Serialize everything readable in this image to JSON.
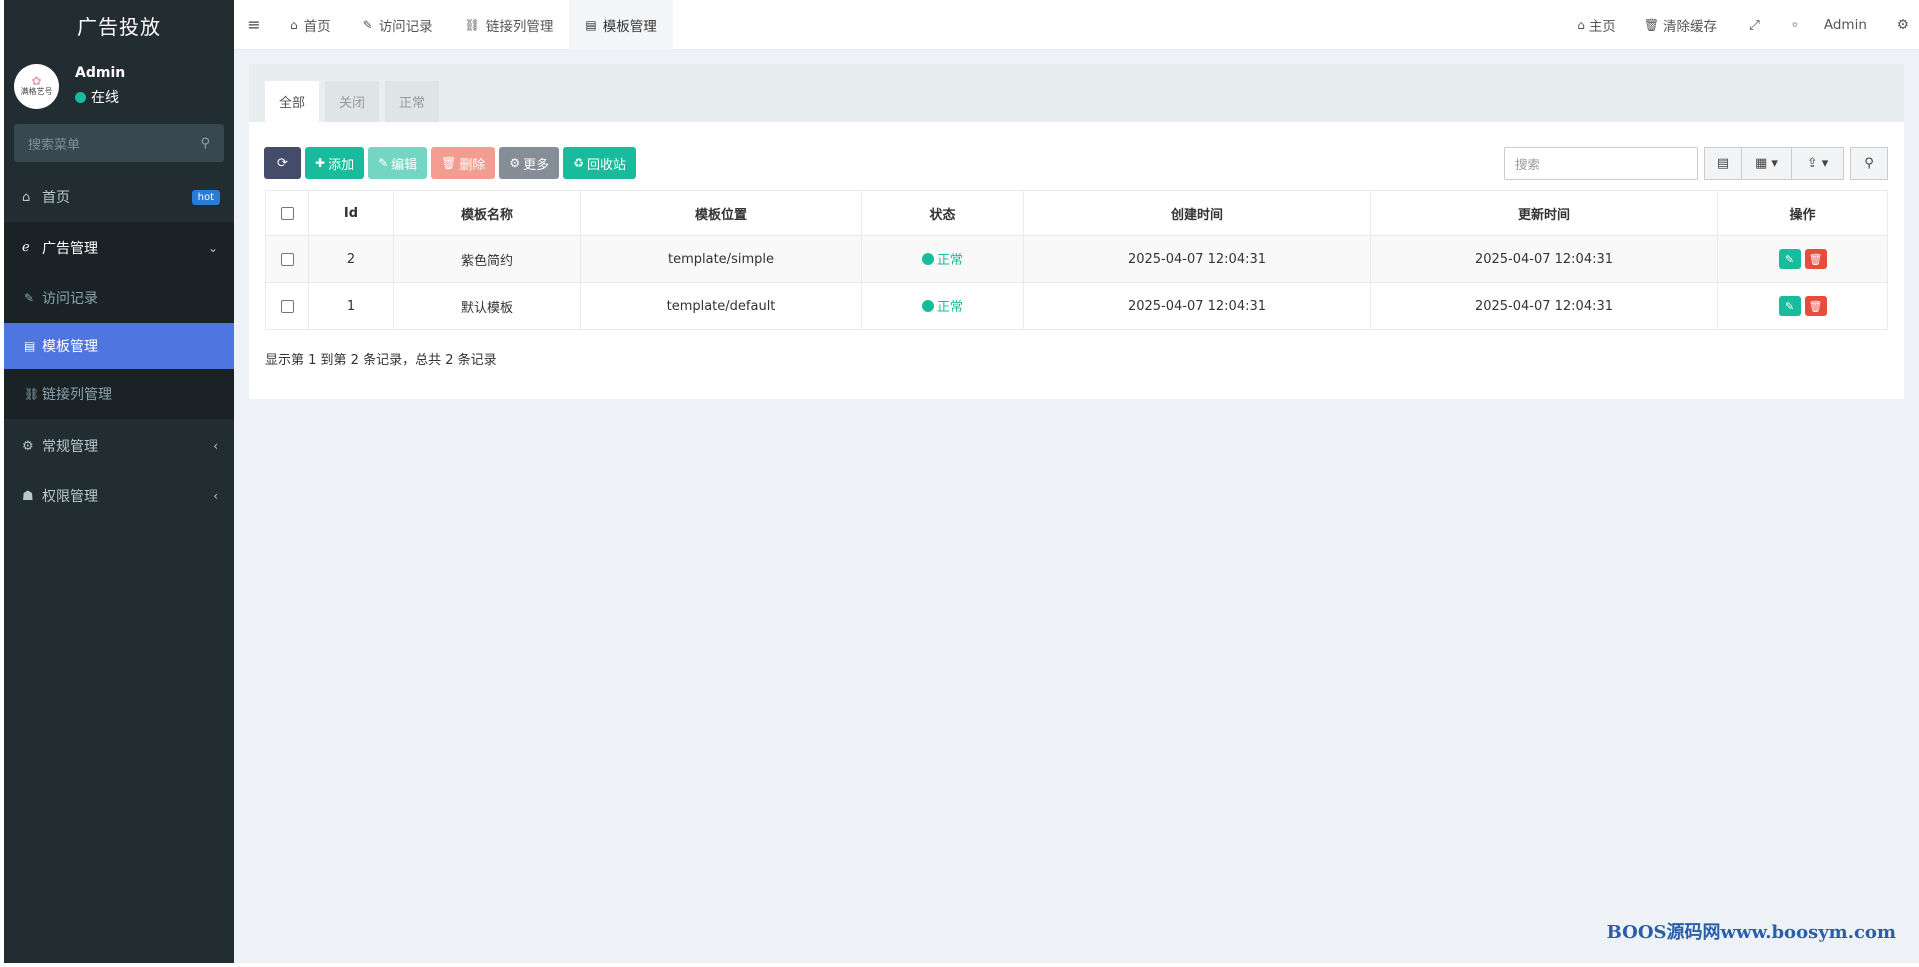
{
  "app": {
    "brand": "广告投放"
  },
  "user": {
    "avatar_text": "满格艺号",
    "name": "Admin",
    "status": "在线"
  },
  "sidebar": {
    "search_placeholder": "搜索菜单",
    "items": [
      {
        "label": "首页",
        "icon": "home-icon",
        "badge": "hot"
      },
      {
        "label": "广告管理",
        "icon": "ie-icon",
        "open": true,
        "children": [
          {
            "label": "访问记录",
            "icon": "pencil-icon"
          },
          {
            "label": "模板管理",
            "icon": "list-icon",
            "active": true
          },
          {
            "label": "链接列管理",
            "icon": "link-icon"
          }
        ]
      },
      {
        "label": "常规管理",
        "icon": "cogs-icon"
      },
      {
        "label": "权限管理",
        "icon": "group-icon"
      }
    ]
  },
  "topbar": {
    "tabs": [
      {
        "label": "首页",
        "icon": "home-icon"
      },
      {
        "label": "访问记录",
        "icon": "pencil-icon"
      },
      {
        "label": "链接列管理",
        "icon": "link-icon"
      },
      {
        "label": "模板管理",
        "icon": "list-icon",
        "active": true
      }
    ],
    "right": {
      "home": "主页",
      "clear_cache": "清除缓存",
      "admin": "Admin"
    }
  },
  "content": {
    "filter_tabs": [
      "全部",
      "关闭",
      "正常"
    ],
    "toolbar": {
      "add": "添加",
      "edit": "编辑",
      "delete": "删除",
      "more": "更多",
      "recycle": "回收站"
    },
    "search_placeholder": "搜索",
    "table": {
      "columns": [
        "Id",
        "模板名称",
        "模板位置",
        "状态",
        "创建时间",
        "更新时间",
        "操作"
      ],
      "rows": [
        {
          "id": "2",
          "name": "紫色简约",
          "path": "template/simple",
          "status": "正常",
          "created": "2025-04-07 12:04:31",
          "updated": "2025-04-07 12:04:31"
        },
        {
          "id": "1",
          "name": "默认模板",
          "path": "template/default",
          "status": "正常",
          "created": "2025-04-07 12:04:31",
          "updated": "2025-04-07 12:04:31"
        }
      ]
    },
    "page_info": "显示第 1 到第 2 条记录，总共 2 条记录"
  },
  "watermark": "BOOS源码网www.boosym.com",
  "colors": {
    "sidebar_bg": "#222d32",
    "active_menu": "#4f76e0",
    "success": "#18bc9c",
    "danger": "#e74c3c"
  }
}
